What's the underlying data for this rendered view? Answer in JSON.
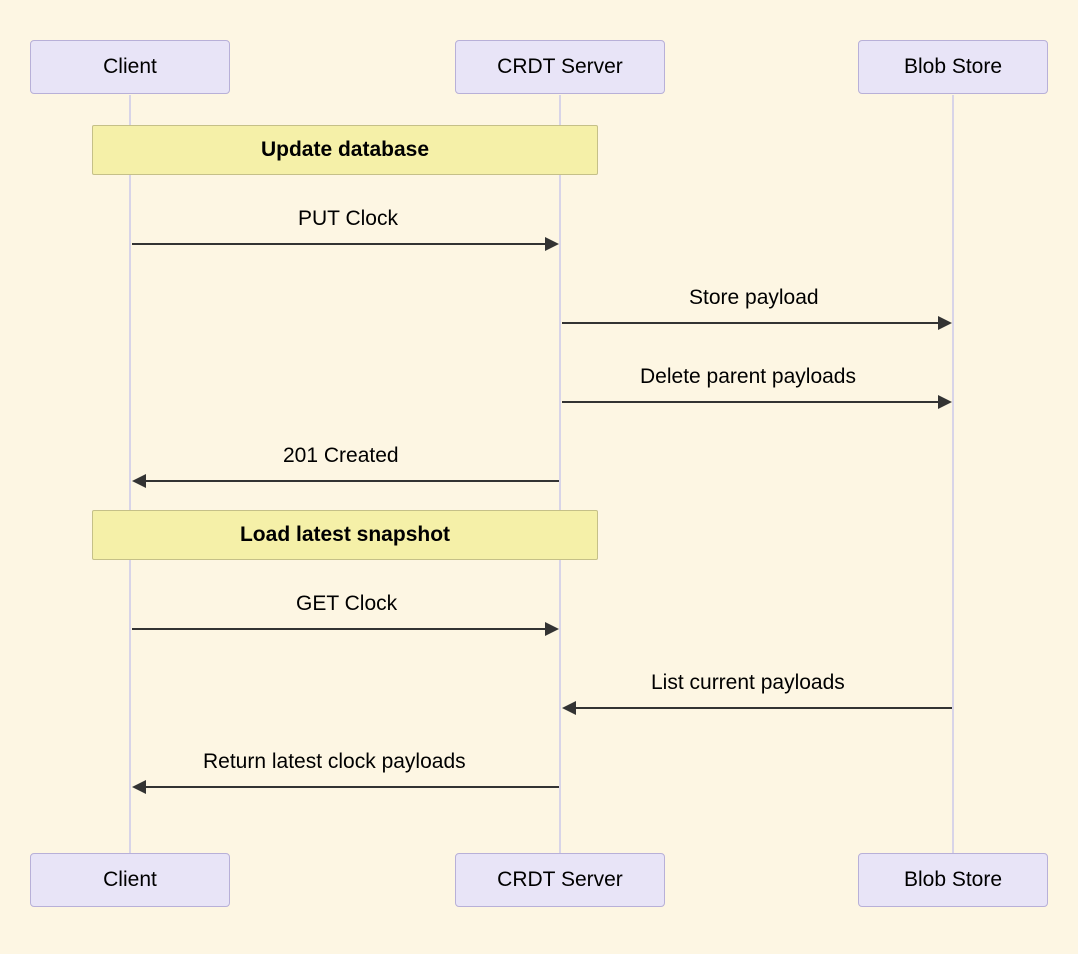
{
  "participants": {
    "client": "Client",
    "server": "CRDT Server",
    "blob": "Blob Store"
  },
  "notes": {
    "update": "Update database",
    "load": "Load latest snapshot"
  },
  "messages": {
    "put_clock": "PUT Clock",
    "store_payload": "Store payload",
    "delete_parent": "Delete parent payloads",
    "created": "201 Created",
    "get_clock": "GET Clock",
    "list_current": "List current payloads",
    "return_latest": "Return latest clock payloads"
  }
}
